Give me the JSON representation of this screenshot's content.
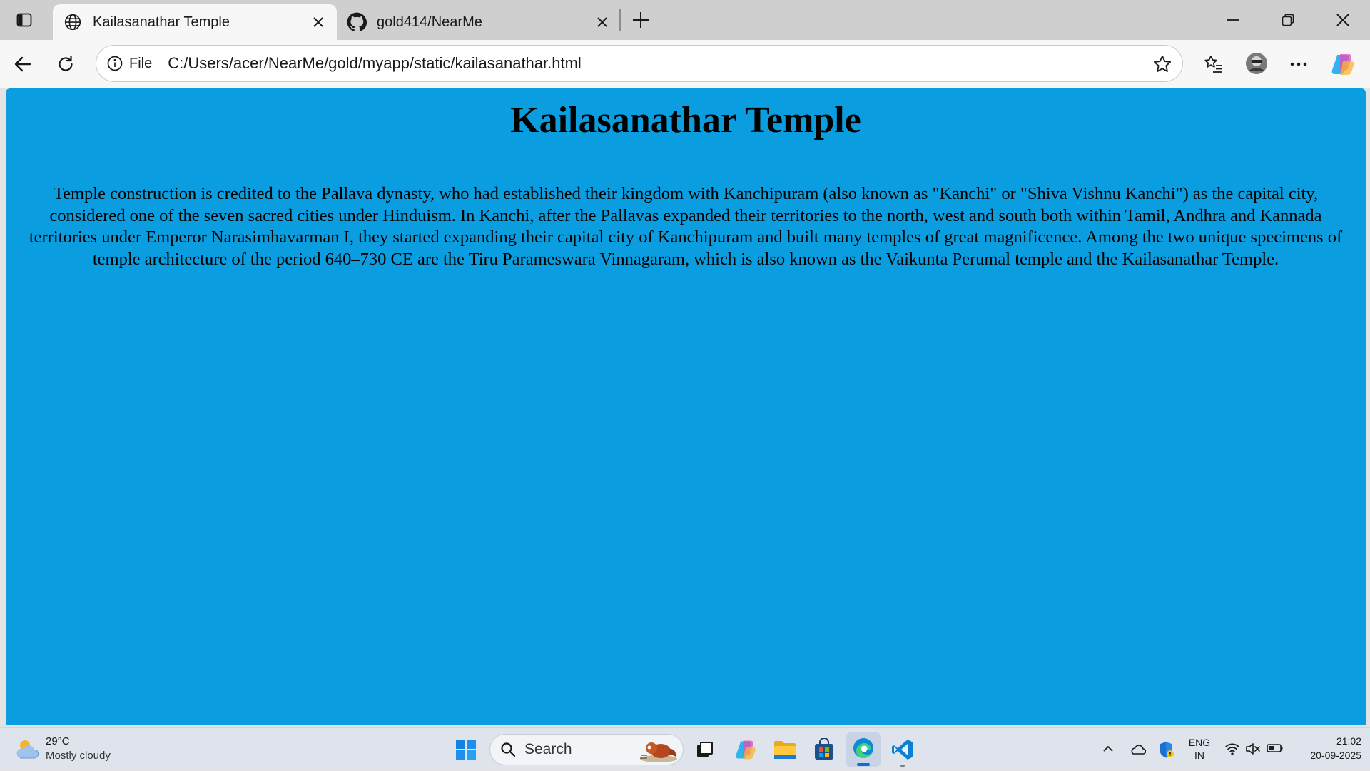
{
  "browser": {
    "tabs": [
      {
        "title": "Kailasanathar Temple",
        "icon": "globe-icon",
        "active": true
      },
      {
        "title": "gold414/NearMe",
        "icon": "github-icon",
        "active": false
      }
    ],
    "address": {
      "scheme_label": "File",
      "url": "C:/Users/acer/NearMe/gold/myapp/static/kailasanathar.html"
    }
  },
  "page": {
    "heading": "Kailasanathar Temple",
    "paragraph": "Temple construction is credited to the Pallava dynasty, who had established their kingdom with Kanchipuram (also known as \"Kanchi\" or \"Shiva Vishnu Kanchi\") as the capital city, considered one of the seven sacred cities under Hinduism. In Kanchi, after the Pallavas expanded their territories to the north, west and south both within Tamil, Andhra and Kannada territories under Emperor Narasimhavarman I, they started expanding their capital city of Kanchipuram and built many temples of great magnificence. Among the two unique specimens of temple architecture of the period 640–730 CE are the Tiru Parameswara Vinnagaram, which is also known as the Vaikunta Perumal temple and the Kailasanathar Temple.",
    "background_color": "#0a9ee0"
  },
  "taskbar": {
    "weather": {
      "temp": "29°C",
      "desc": "Mostly cloudy"
    },
    "search_label": "Search",
    "language": {
      "line1": "ENG",
      "line2": "IN"
    },
    "clock": {
      "time": "21:02",
      "date": "20-09-2025"
    }
  }
}
